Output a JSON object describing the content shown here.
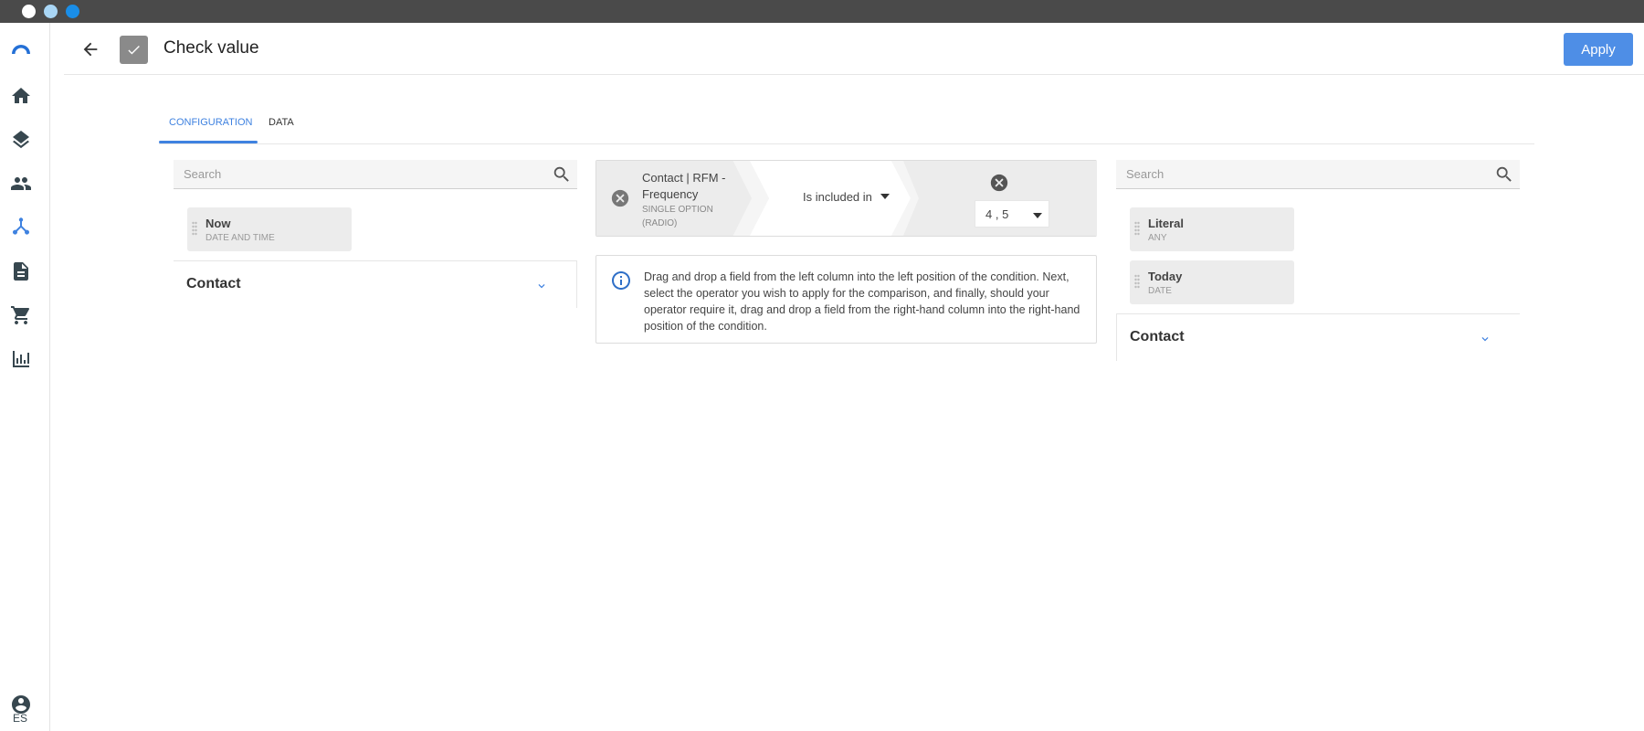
{
  "window": {
    "controls": [
      "close",
      "minimize",
      "maximize"
    ]
  },
  "sidebar": {
    "items": [
      {
        "icon": "logo-icon"
      },
      {
        "icon": "home-icon"
      },
      {
        "icon": "layers-icon"
      },
      {
        "icon": "people-icon"
      },
      {
        "icon": "flow-icon",
        "active": true
      },
      {
        "icon": "document-icon"
      },
      {
        "icon": "cart-icon"
      },
      {
        "icon": "bar-chart-icon"
      }
    ],
    "account_icon": "account-circle-icon",
    "language": "ES"
  },
  "header": {
    "title": "Check value",
    "apply_label": "Apply"
  },
  "tabs": [
    {
      "label": "CONFIGURATION",
      "active": true
    },
    {
      "label": "DATA",
      "active": false
    }
  ],
  "left_panel": {
    "search_placeholder": "Search",
    "fields": [
      {
        "name": "Now",
        "type": "DATE AND TIME"
      }
    ],
    "group": "Contact"
  },
  "condition": {
    "field": "Contact | RFM - Frequency",
    "field_type": "SINGLE OPTION (RADIO)",
    "operator": "Is included in",
    "value": "4 , 5"
  },
  "info": {
    "text": "Drag and drop a field from the left column into the left position of the condition. Next, select the operator you wish to apply for the comparison, and finally, should your operator require it, drag and drop a field from the right-hand column into the right-hand position of the condition."
  },
  "right_panel": {
    "search_placeholder": "Search",
    "fields": [
      {
        "name": "Literal",
        "type": "ANY"
      },
      {
        "name": "Today",
        "type": "DATE"
      }
    ],
    "group": "Contact"
  },
  "colors": {
    "accent": "#3f82e0",
    "apply": "#4e8ee6",
    "chrome": "#4a4a4a"
  }
}
